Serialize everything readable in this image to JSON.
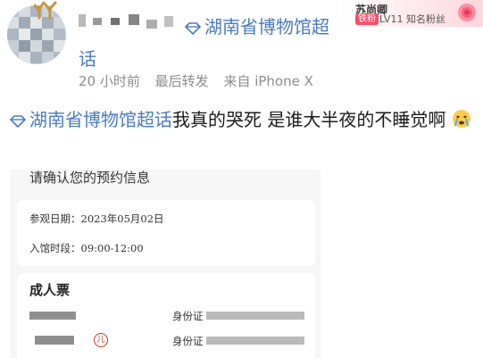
{
  "post_header": {
    "topic_line1": "湖南省博物馆超",
    "topic_line2": "话",
    "meta": {
      "time": "20 小时前",
      "action": "最后转发",
      "source": "来自 iPhone X"
    }
  },
  "fan_badge": {
    "name": "苏尚卿",
    "tag": "铁粉",
    "level": "LV11 知名粉丝"
  },
  "post_body": {
    "topic": "湖南省博物馆超话",
    "text": "我真的哭死  是谁大半夜的不睡觉啊",
    "emoji": "cry-emoji"
  },
  "screenshot": {
    "title": "请确认您的预约信息",
    "visit_date_label": "参观日期：2023年05月02日",
    "entry_time_label": "入馆时段：09:00-12:00",
    "ticket_title": "成人票",
    "id_label_1": "身份证",
    "id_label_2": "身份证"
  },
  "colors": {
    "topic_blue": "#4a7bbf",
    "meta_gray": "#8c8c8c",
    "badge_pink": "#ff4b6a"
  }
}
